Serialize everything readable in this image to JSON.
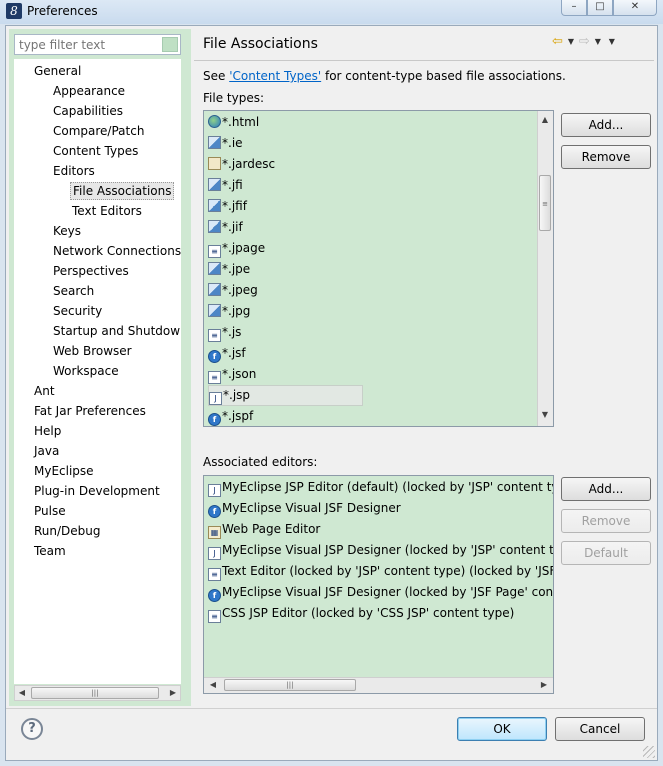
{
  "window": {
    "title": "Preferences",
    "app_icon_glyph": "8",
    "buttons": [
      "–",
      "□",
      "✕"
    ]
  },
  "filter": {
    "placeholder": "type filter text"
  },
  "tree": {
    "items": [
      {
        "label": "General",
        "indent": 0
      },
      {
        "label": "Appearance",
        "indent": 1
      },
      {
        "label": "Capabilities",
        "indent": 1
      },
      {
        "label": "Compare/Patch",
        "indent": 1
      },
      {
        "label": "Content Types",
        "indent": 1
      },
      {
        "label": "Editors",
        "indent": 1
      },
      {
        "label": "File Associations",
        "indent": 2,
        "selected": true
      },
      {
        "label": "Text Editors",
        "indent": 2
      },
      {
        "label": "Keys",
        "indent": 1
      },
      {
        "label": "Network Connections",
        "indent": 1
      },
      {
        "label": "Perspectives",
        "indent": 1
      },
      {
        "label": "Search",
        "indent": 1
      },
      {
        "label": "Security",
        "indent": 1
      },
      {
        "label": "Startup and Shutdown",
        "indent": 1
      },
      {
        "label": "Web Browser",
        "indent": 1
      },
      {
        "label": "Workspace",
        "indent": 1
      },
      {
        "label": "Ant",
        "indent": 0
      },
      {
        "label": "Fat Jar Preferences",
        "indent": 0
      },
      {
        "label": "Help",
        "indent": 0
      },
      {
        "label": "Java",
        "indent": 0
      },
      {
        "label": "MyEclipse",
        "indent": 0
      },
      {
        "label": "Plug-in Development",
        "indent": 0
      },
      {
        "label": "Pulse",
        "indent": 0
      },
      {
        "label": "Run/Debug",
        "indent": 0
      },
      {
        "label": "Team",
        "indent": 0
      }
    ]
  },
  "page": {
    "title": "File Associations",
    "see_prefix": "See ",
    "see_link": "'Content Types'",
    "see_suffix": " for content-type based file associations.",
    "file_types_label": "File types:",
    "associated_label": "Associated editors:"
  },
  "file_types": [
    {
      "label": "*.html",
      "icon": "globe"
    },
    {
      "label": "*.ie",
      "icon": "img"
    },
    {
      "label": "*.jardesc",
      "icon": "jar"
    },
    {
      "label": "*.jfi",
      "icon": "img"
    },
    {
      "label": "*.jfif",
      "icon": "img"
    },
    {
      "label": "*.jif",
      "icon": "img"
    },
    {
      "label": "*.jpage",
      "icon": "page"
    },
    {
      "label": "*.jpe",
      "icon": "img"
    },
    {
      "label": "*.jpeg",
      "icon": "img"
    },
    {
      "label": "*.jpg",
      "icon": "img"
    },
    {
      "label": "*.js",
      "icon": "page"
    },
    {
      "label": "*.jsf",
      "icon": "jsf"
    },
    {
      "label": "*.json",
      "icon": "page"
    },
    {
      "label": "*.jsp",
      "icon": "jsp",
      "selected": true
    },
    {
      "label": "*.jspf",
      "icon": "jsf"
    }
  ],
  "editors": [
    {
      "label": "MyEclipse JSP Editor (default) (locked by 'JSP' content type)",
      "icon": "jsp"
    },
    {
      "label": "MyEclipse Visual JSF Designer",
      "icon": "jsf"
    },
    {
      "label": "Web Page Editor",
      "icon": "web"
    },
    {
      "label": "MyEclipse Visual JSP Designer (locked by 'JSP' content type)",
      "icon": "jsp"
    },
    {
      "label": "Text Editor (locked by 'JSP' content type) (locked by 'JSF Page' content type)",
      "icon": "page"
    },
    {
      "label": "MyEclipse Visual JSF Designer (locked by 'JSF Page' content type)",
      "icon": "jsf"
    },
    {
      "label": "CSS JSP Editor (locked by 'CSS JSP' content type)",
      "icon": "page"
    }
  ],
  "buttons": {
    "add1": "Add...",
    "remove1": "Remove",
    "add2": "Add...",
    "remove2": "Remove",
    "default": "Default",
    "ok": "OK",
    "cancel": "Cancel"
  },
  "help": {
    "glyph": "?"
  },
  "icons": {
    "back": "arrow-left-icon",
    "forward": "arrow-right-icon",
    "view_menu": "chevron-down-icon"
  },
  "colors": {
    "list_bg": "#cfe8d2",
    "link": "#0064c8",
    "back_arrow": "#d8a000"
  }
}
